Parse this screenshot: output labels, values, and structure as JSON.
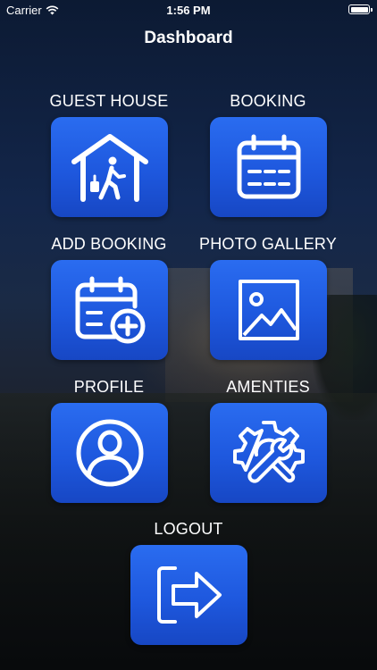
{
  "status_bar": {
    "carrier": "Carrier",
    "time": "1:56 PM",
    "icons": [
      "wifi-icon",
      "battery-icon"
    ]
  },
  "nav": {
    "title": "Dashboard"
  },
  "tiles": [
    {
      "label": "GUEST HOUSE",
      "icon": "guest-house-icon"
    },
    {
      "label": "BOOKING",
      "icon": "calendar-icon"
    },
    {
      "label": "ADD BOOKING",
      "icon": "calendar-add-icon"
    },
    {
      "label": "PHOTO GALLERY",
      "icon": "image-icon"
    },
    {
      "label": "PROFILE",
      "icon": "user-icon"
    },
    {
      "label": "AMENTIES",
      "icon": "settings-wrench-icon"
    },
    {
      "label": "LOGOUT",
      "icon": "logout-icon"
    }
  ],
  "colors": {
    "tile_blue": "#1e58de",
    "text": "#ffffff"
  }
}
